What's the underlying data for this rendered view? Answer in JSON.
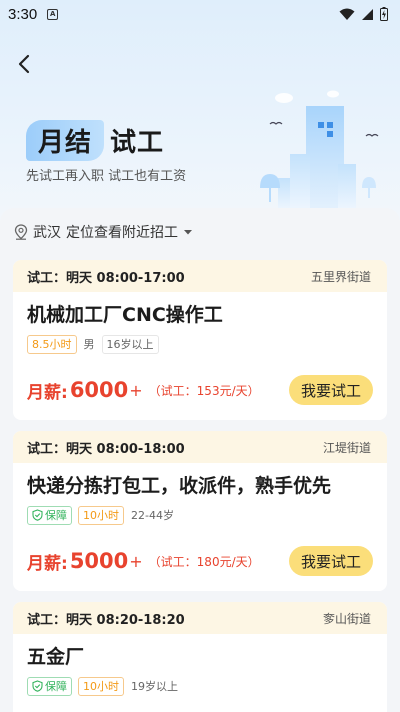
{
  "status_bar": {
    "time": "3:30",
    "app_icon_letter": "A"
  },
  "header": {
    "title_highlight": "月结",
    "title_rest": "试工",
    "subtitle": "先试工再入职 试工也有工资"
  },
  "location": {
    "city": "武汉",
    "hint": "定位查看附近招工"
  },
  "jobs": [
    {
      "time": "试工：明天 08:00-17:00",
      "street": "五里界街道",
      "title": "机械加工厂CNC操作工",
      "tags": [
        {
          "text": "8.5小时",
          "style": "orange"
        },
        {
          "text": "男",
          "style": "none"
        },
        {
          "text": "16岁以上",
          "style": "plain"
        }
      ],
      "pay_label": "月薪:",
      "pay_amount": "6000",
      "pay_plus": "+",
      "trial_pay": "（试工：153元/天）",
      "apply": "我要试工"
    },
    {
      "time": "试工：明天 08:00-18:00",
      "street": "江堤街道",
      "title": "快递分拣打包工，收派件，熟手优先",
      "tags": [
        {
          "text": "保障",
          "style": "green"
        },
        {
          "text": "10小时",
          "style": "orange"
        },
        {
          "text": "22-44岁",
          "style": "none"
        }
      ],
      "pay_label": "月薪:",
      "pay_amount": "5000",
      "pay_plus": "+",
      "trial_pay": "（试工：180元/天）",
      "apply": "我要试工"
    },
    {
      "time": "试工：明天 08:20-18:20",
      "street": "奓山街道",
      "title": "五金厂",
      "tags": [
        {
          "text": "保障",
          "style": "green"
        },
        {
          "text": "10小时",
          "style": "orange"
        },
        {
          "text": "19岁以上",
          "style": "none"
        }
      ],
      "pay_label": "",
      "pay_amount": "",
      "pay_plus": "",
      "trial_pay": "",
      "apply": ""
    }
  ],
  "colors": {
    "accent_red": "#e8432e",
    "button_yellow": "#fbde7a",
    "card_header": "#fdf6e4",
    "hero_blue": "#dfeefb"
  },
  "icons": [
    "back-icon",
    "location-pin-icon",
    "caret-down-icon",
    "shield-check-icon",
    "wifi-icon",
    "signal-icon",
    "battery-icon"
  ]
}
